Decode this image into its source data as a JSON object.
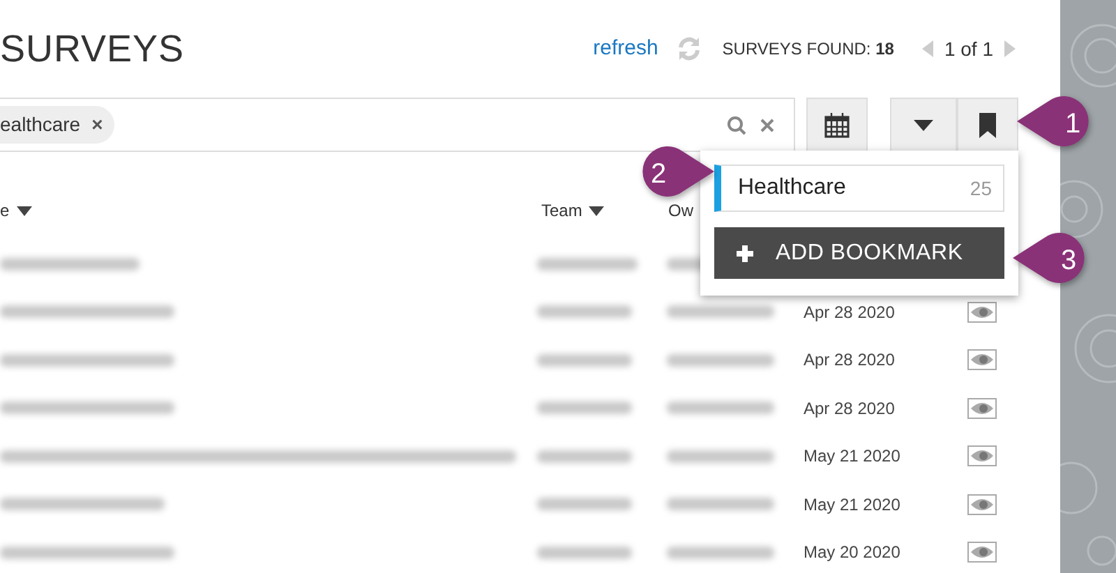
{
  "page_title": "SURVEYS",
  "header": {
    "refresh": "refresh",
    "found_label": "SURVEYS FOUND:",
    "found_count": "18",
    "pager": "1 of 1"
  },
  "search": {
    "chips": [
      {
        "label": "ealthcare",
        "remove": "×"
      }
    ]
  },
  "table": {
    "columns": [
      {
        "label": "e",
        "sortable": true
      },
      {
        "label": "Team",
        "sortable": true
      },
      {
        "label": "Ow",
        "sortable": false
      }
    ],
    "rows": [
      {},
      {
        "date": "Apr 28 2020"
      },
      {
        "date": "Apr 28 2020"
      },
      {
        "date": "Apr 28 2020"
      },
      {
        "date": "May 21 2020"
      },
      {
        "date": "May 21 2020"
      },
      {
        "date": "May 20 2020"
      }
    ]
  },
  "bookmark_menu": {
    "items": [
      {
        "label": "Healthcare",
        "count": "25",
        "selected": true
      }
    ],
    "add_button": "ADD BOOKMARK"
  },
  "callouts": [
    {
      "number": "1"
    },
    {
      "number": "2"
    },
    {
      "number": "3"
    }
  ]
}
